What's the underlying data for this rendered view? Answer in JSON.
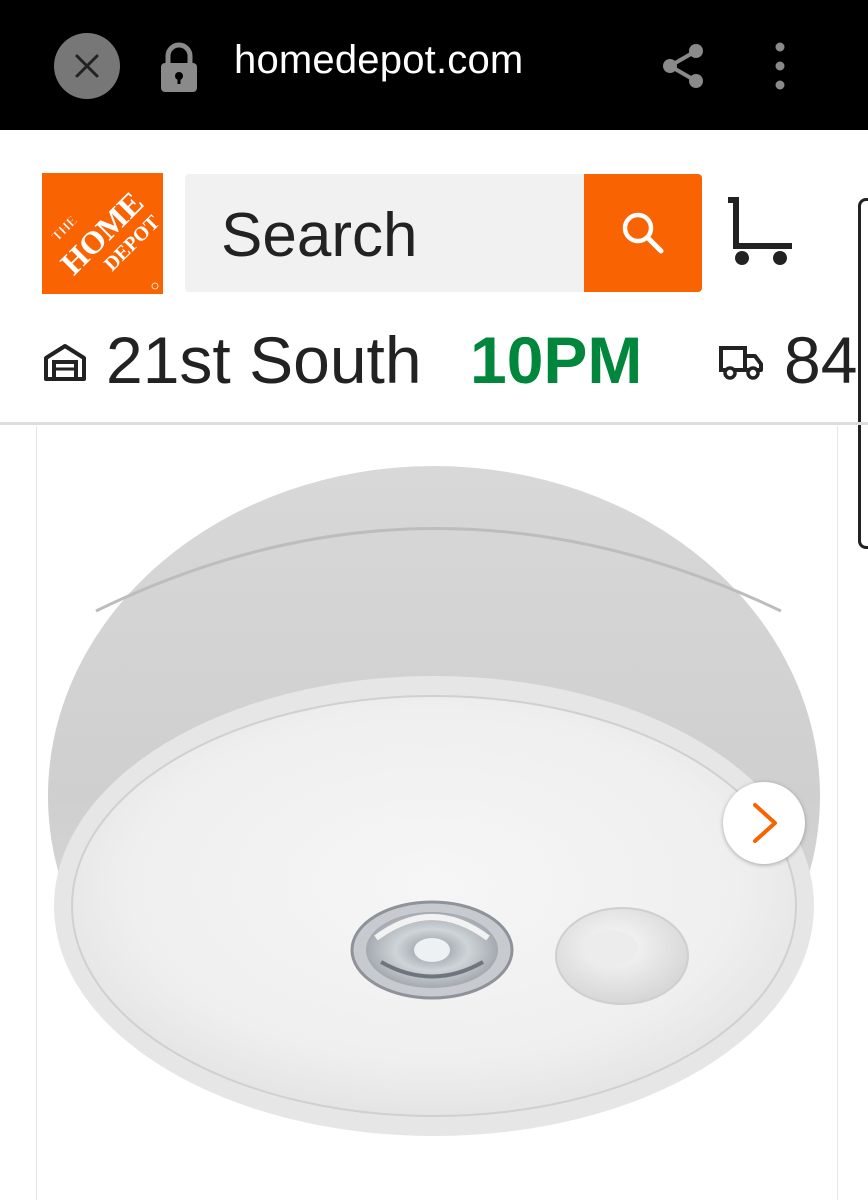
{
  "browser": {
    "url": "homedepot.com",
    "icons": [
      "close-icon",
      "lock-icon",
      "share-icon",
      "more-vert-icon"
    ]
  },
  "header": {
    "logo_icon": "home-depot-logo",
    "search_placeholder": "Search",
    "search_icon": "search-icon",
    "cart_icon": "cart-icon",
    "brand_color": "#f96302"
  },
  "store": {
    "store_icon": "store-icon",
    "name": "21st South",
    "hours": "10PM",
    "hours_color": "#00873c",
    "delivery_icon": "truck-icon",
    "delivery_zip": "84"
  },
  "product": {
    "image_icon": "ceiling-light-image",
    "next_icon": "chevron-right-icon"
  }
}
